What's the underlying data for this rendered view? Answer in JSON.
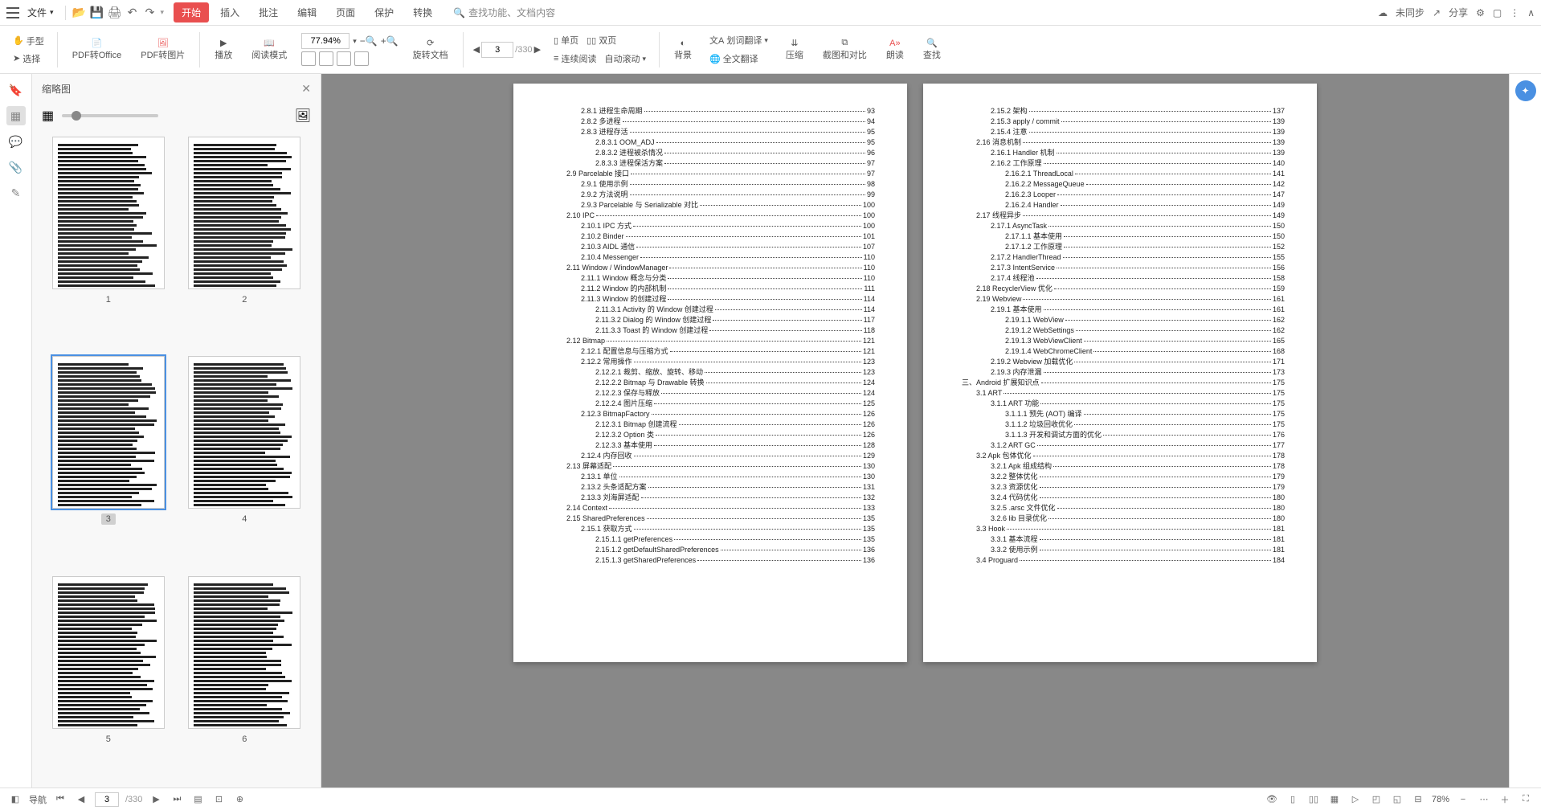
{
  "menu": {
    "file_label": "文件",
    "tabs": [
      "开始",
      "插入",
      "批注",
      "编辑",
      "页面",
      "保护",
      "转换"
    ],
    "active_tab": 0,
    "search_placeholder": "查找功能、文档内容",
    "sync": "未同步",
    "share": "分享"
  },
  "ribbon": {
    "hand": "手型",
    "select": "选择",
    "pdf_office": "PDF转Office",
    "pdf_image": "PDF转图片",
    "play": "播放",
    "read_mode": "阅读模式",
    "zoom_value": "77.94%",
    "rotate": "旋转文档",
    "page_input": "3",
    "page_total": "/330",
    "single": "单页",
    "double": "双页",
    "continuous": "连续阅读",
    "auto_scroll": "自动滚动",
    "background": "背景",
    "word_trans": "划词翻译",
    "full_trans": "全文翻译",
    "compress": "压缩",
    "screenshot": "截图和对比",
    "read_aloud": "朗读",
    "find": "查找"
  },
  "thumbs": {
    "title": "缩略图",
    "nums": [
      "1",
      "2",
      "3",
      "4",
      "5",
      "6"
    ],
    "selected": 2
  },
  "toc_left": [
    {
      "i": 2,
      "t": "2.8.1 进程生命周期",
      "p": "93"
    },
    {
      "i": 2,
      "t": "2.8.2 多进程",
      "p": "94"
    },
    {
      "i": 2,
      "t": "2.8.3 进程存活",
      "p": "95"
    },
    {
      "i": 3,
      "t": "2.8.3.1 OOM_ADJ",
      "p": "95"
    },
    {
      "i": 3,
      "t": "2.8.3.2 进程被杀情况",
      "p": "96"
    },
    {
      "i": 3,
      "t": "2.8.3.3 进程保活方案",
      "p": "97"
    },
    {
      "i": 1,
      "t": "2.9 Parcelable  接口",
      "p": "97"
    },
    {
      "i": 2,
      "t": "2.9.1 使用示例",
      "p": "98"
    },
    {
      "i": 2,
      "t": "2.9.2 方法说明",
      "p": "99"
    },
    {
      "i": 2,
      "t": "2.9.3 Parcelable  与  Serializable  对比",
      "p": "100"
    },
    {
      "i": 1,
      "t": "2.10 IPC",
      "p": "100"
    },
    {
      "i": 2,
      "t": "2.10.1 IPC 方式",
      "p": "100"
    },
    {
      "i": 2,
      "t": "2.10.2 Binder",
      "p": "101"
    },
    {
      "i": 2,
      "t": "2.10.3 AIDL 通信",
      "p": "107"
    },
    {
      "i": 2,
      "t": "2.10.4 Messenger",
      "p": "110"
    },
    {
      "i": 1,
      "t": "2.11 Window / WindowManager",
      "p": "110"
    },
    {
      "i": 2,
      "t": "2.11.1 Window  概念与分类",
      "p": "110"
    },
    {
      "i": 2,
      "t": "2.11.2 Window  的内部机制",
      "p": "111"
    },
    {
      "i": 2,
      "t": "2.11.3 Window  的创建过程",
      "p": "114"
    },
    {
      "i": 3,
      "t": "2.11.3.1 Activity 的  Window  创建过程",
      "p": "114"
    },
    {
      "i": 3,
      "t": "2.11.3.2 Dialog 的  Window  创建过程",
      "p": "117"
    },
    {
      "i": 3,
      "t": "2.11.3.3 Toast 的  Window  创建过程",
      "p": "118"
    },
    {
      "i": 1,
      "t": "2.12 Bitmap",
      "p": "121"
    },
    {
      "i": 2,
      "t": "2.12.1 配置信息与压缩方式",
      "p": "121"
    },
    {
      "i": 2,
      "t": "2.12.2 常用操作",
      "p": "123"
    },
    {
      "i": 3,
      "t": "2.12.2.1 裁剪、缩放、旋转、移动",
      "p": "123"
    },
    {
      "i": 3,
      "t": "2.12.2.2 Bitmap 与 Drawable 转换",
      "p": "124"
    },
    {
      "i": 3,
      "t": "2.12.2.3 保存与释放",
      "p": "124"
    },
    {
      "i": 3,
      "t": "2.12.2.4 图片压缩",
      "p": "125"
    },
    {
      "i": 2,
      "t": "2.12.3 BitmapFactory",
      "p": "126"
    },
    {
      "i": 3,
      "t": "2.12.3.1 Bitmap 创建流程",
      "p": "126"
    },
    {
      "i": 3,
      "t": "2.12.3.2 Option 类",
      "p": "126"
    },
    {
      "i": 3,
      "t": "2.12.3.3 基本使用",
      "p": "128"
    },
    {
      "i": 2,
      "t": "2.12.4 内存回收",
      "p": "129"
    },
    {
      "i": 1,
      "t": "2.13  屏幕适配",
      "p": "130"
    },
    {
      "i": 2,
      "t": "2.13.1 单位",
      "p": "130"
    },
    {
      "i": 2,
      "t": "2.13.2 头条适配方案",
      "p": "131"
    },
    {
      "i": 2,
      "t": "2.13.3 刘海屏适配",
      "p": "132"
    },
    {
      "i": 1,
      "t": "2.14 Context",
      "p": "133"
    },
    {
      "i": 1,
      "t": "2.15 SharedPreferences",
      "p": "135"
    },
    {
      "i": 2,
      "t": "2.15.1 获取方式",
      "p": "135"
    },
    {
      "i": 3,
      "t": "2.15.1.1 getPreferences",
      "p": "135"
    },
    {
      "i": 3,
      "t": "2.15.1.2 getDefaultSharedPreferences",
      "p": "136"
    },
    {
      "i": 3,
      "t": "2.15.1.3 getSharedPreferences",
      "p": "136"
    }
  ],
  "toc_right": [
    {
      "i": 2,
      "t": "2.15.2 架构",
      "p": "137"
    },
    {
      "i": 2,
      "t": "2.15.3 apply / commit",
      "p": "139"
    },
    {
      "i": 2,
      "t": "2.15.4 注意",
      "p": "139"
    },
    {
      "i": 1,
      "t": "2.16  消息机制",
      "p": "139"
    },
    {
      "i": 2,
      "t": "2.16.1 Handler  机制",
      "p": "139"
    },
    {
      "i": 2,
      "t": "2.16.2 工作原理",
      "p": "140"
    },
    {
      "i": 3,
      "t": "2.16.2.1 ThreadLocal",
      "p": "141"
    },
    {
      "i": 3,
      "t": "2.16.2.2 MessageQueue",
      "p": "142"
    },
    {
      "i": 3,
      "t": "2.16.2.3 Looper",
      "p": "147"
    },
    {
      "i": 3,
      "t": "2.16.2.4 Handler",
      "p": "149"
    },
    {
      "i": 1,
      "t": "2.17  线程异步",
      "p": "149"
    },
    {
      "i": 2,
      "t": "2.17.1 AsyncTask",
      "p": "150"
    },
    {
      "i": 3,
      "t": "2.17.1.1 基本使用",
      "p": "150"
    },
    {
      "i": 3,
      "t": "2.17.1.2 工作原理",
      "p": "152"
    },
    {
      "i": 2,
      "t": "2.17.2 HandlerThread",
      "p": "155"
    },
    {
      "i": 2,
      "t": "2.17.3 IntentService",
      "p": "156"
    },
    {
      "i": 2,
      "t": "2.17.4 线程池",
      "p": "158"
    },
    {
      "i": 1,
      "t": "2.18 RecyclerView 优化",
      "p": "159"
    },
    {
      "i": 1,
      "t": "2.19 Webview",
      "p": "161"
    },
    {
      "i": 2,
      "t": "2.19.1 基本使用",
      "p": "161"
    },
    {
      "i": 3,
      "t": "2.19.1.1 WebView",
      "p": "162"
    },
    {
      "i": 3,
      "t": "2.19.1.2 WebSettings",
      "p": "162"
    },
    {
      "i": 3,
      "t": "2.19.1.3 WebViewClient",
      "p": "165"
    },
    {
      "i": 3,
      "t": "2.19.1.4 WebChromeClient",
      "p": "168"
    },
    {
      "i": 2,
      "t": "2.19.2 Webview  加载优化",
      "p": "171"
    },
    {
      "i": 2,
      "t": "2.19.3 内存泄漏",
      "p": "173"
    },
    {
      "i": 0,
      "t": "三、Android 扩展知识点",
      "p": "175"
    },
    {
      "i": 1,
      "t": "3.1 ART",
      "p": "175"
    },
    {
      "i": 2,
      "t": "3.1.1 ART  功能",
      "p": "175"
    },
    {
      "i": 3,
      "t": "3.1.1.1 预先 (AOT) 编译",
      "p": "175"
    },
    {
      "i": 3,
      "t": "3.1.1.2 垃圾回收优化",
      "p": "175"
    },
    {
      "i": 3,
      "t": "3.1.1.3 开发和调试方面的优化",
      "p": "176"
    },
    {
      "i": 2,
      "t": "3.1.2 ART GC",
      "p": "177"
    },
    {
      "i": 1,
      "t": "3.2 Apk  包体优化",
      "p": "178"
    },
    {
      "i": 2,
      "t": "3.2.1 Apk  组成结构",
      "p": "178"
    },
    {
      "i": 2,
      "t": "3.2.2 整体优化",
      "p": "179"
    },
    {
      "i": 2,
      "t": "3.2.3 资源优化",
      "p": "179"
    },
    {
      "i": 2,
      "t": "3.2.4 代码优化",
      "p": "180"
    },
    {
      "i": 2,
      "t": "3.2.5 .arsc 文件优化",
      "p": "180"
    },
    {
      "i": 2,
      "t": "3.2.6 lib 目录优化",
      "p": "180"
    },
    {
      "i": 1,
      "t": "3.3 Hook",
      "p": "181"
    },
    {
      "i": 2,
      "t": "3.3.1 基本流程",
      "p": "181"
    },
    {
      "i": 2,
      "t": "3.3.2 使用示例",
      "p": "181"
    },
    {
      "i": 1,
      "t": "3.4 Proguard",
      "p": "184"
    }
  ],
  "status": {
    "nav": "导航",
    "page_input": "3",
    "page_total": "/330",
    "zoom": "78%"
  }
}
